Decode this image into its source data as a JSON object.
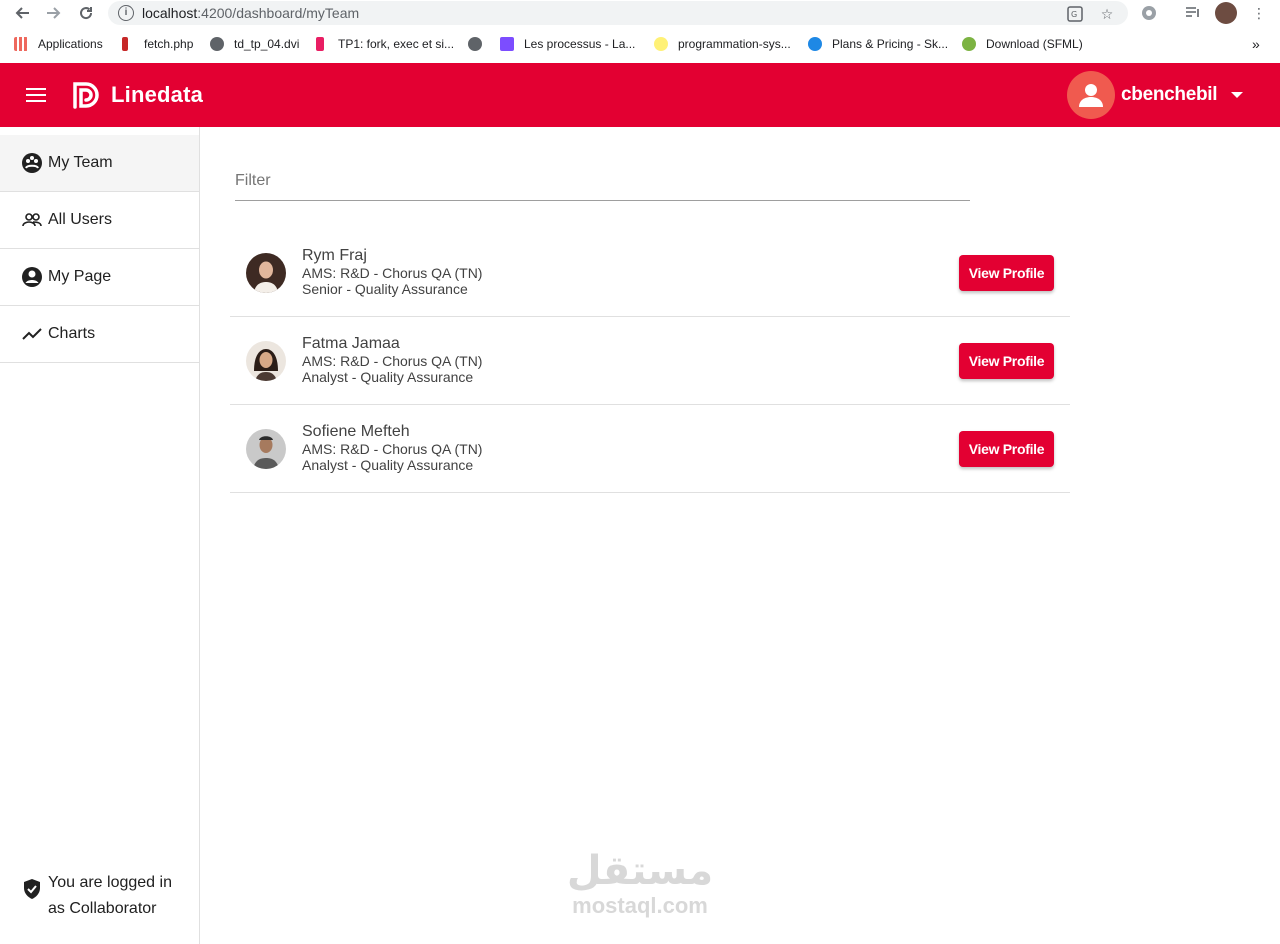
{
  "browser": {
    "url_host": "localhost",
    "url_rest": ":4200/dashboard/myTeam",
    "bookmarks": [
      {
        "label": "Applications",
        "color": "#4285f4"
      },
      {
        "label": "fetch.php",
        "color": "#c62828"
      },
      {
        "label": "td_tp_04.dvi",
        "color": "#5f6368"
      },
      {
        "label": "TP1: fork, exec et si...",
        "color": "#e91e63"
      },
      {
        "label": "",
        "color": "#5f6368"
      },
      {
        "label": "Les processus - La...",
        "color": "#7c4dff"
      },
      {
        "label": "programmation-sys...",
        "color": "#fff176"
      },
      {
        "label": "Plans & Pricing - Sk...",
        "color": "#1e88e5"
      },
      {
        "label": "Download (SFML)",
        "color": "#7cb342"
      }
    ],
    "more": "»"
  },
  "header": {
    "brand": "Linedata",
    "username": "cbenchebil",
    "brand_color": "#e30032"
  },
  "sidebar": {
    "items": [
      {
        "label": "My Team",
        "icon": "team-icon",
        "active": true
      },
      {
        "label": "All Users",
        "icon": "users-icon",
        "active": false
      },
      {
        "label": "My Page",
        "icon": "account-icon",
        "active": false
      },
      {
        "label": "Charts",
        "icon": "trend-icon",
        "active": false
      }
    ],
    "status_line1": "You are logged in",
    "status_line2": "as Collaborator"
  },
  "main": {
    "filter_placeholder": "Filter",
    "members": [
      {
        "name": "Rym Fraj",
        "department": "AMS: R&D - Chorus QA (TN)",
        "role": "Senior - Quality Assurance",
        "button": "View Profile"
      },
      {
        "name": "Fatma Jamaa",
        "department": "AMS: R&D - Chorus QA (TN)",
        "role": "Analyst - Quality Assurance",
        "button": "View Profile"
      },
      {
        "name": "Sofiene Mefteh",
        "department": "AMS: R&D - Chorus QA (TN)",
        "role": "Analyst - Quality Assurance",
        "button": "View Profile"
      }
    ]
  },
  "watermark": {
    "arabic": "مستقل",
    "latin": "mostaql.com"
  }
}
